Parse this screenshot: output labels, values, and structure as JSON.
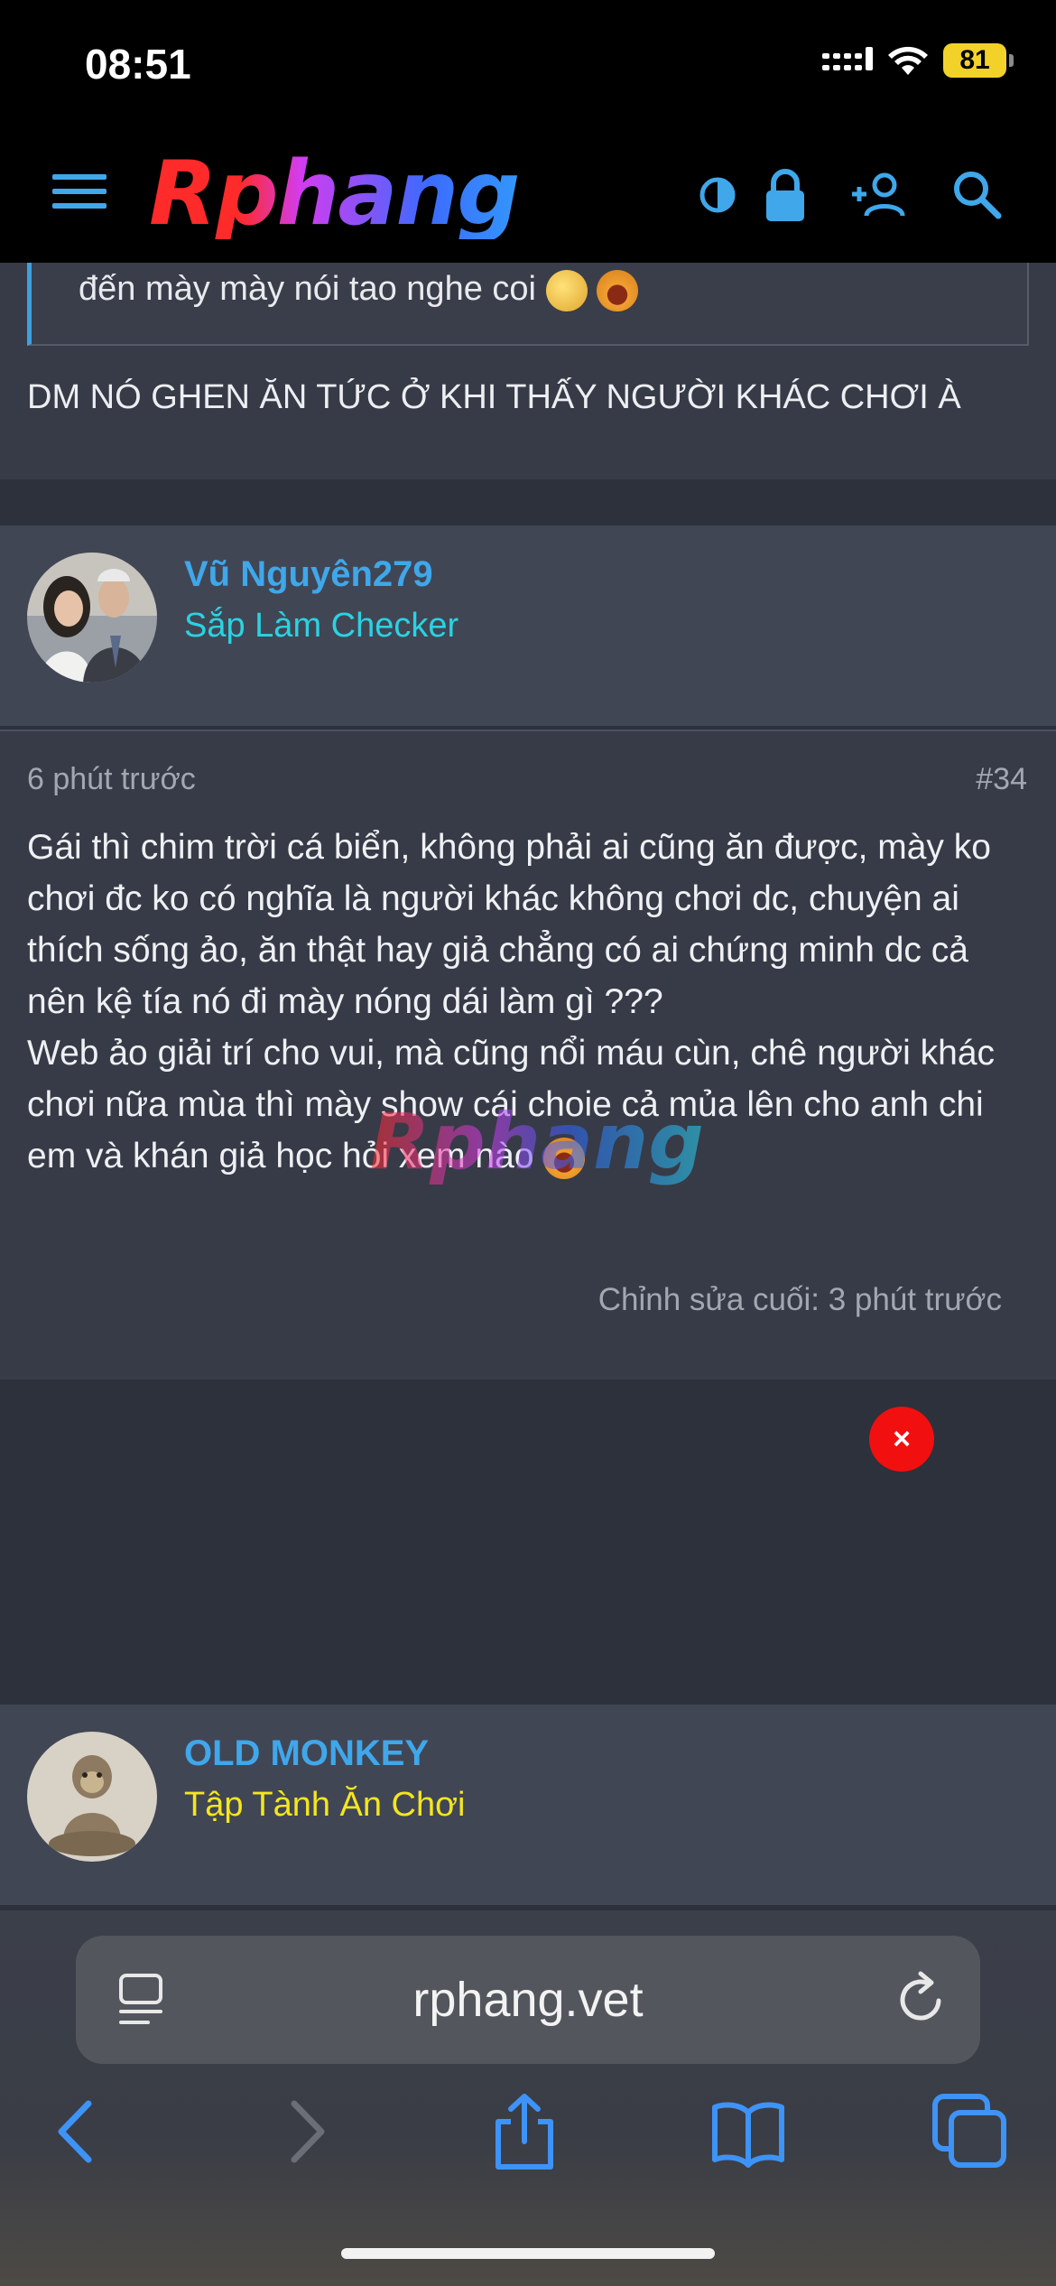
{
  "status_bar": {
    "time": "08:51",
    "battery": "81"
  },
  "header": {
    "logo": "Rphang"
  },
  "prev_post": {
    "quote_text": "đến mày mày nói tao nghe coi",
    "body": "DM NÓ GHEN ĂN TỨC Ở KHI THẤY NGƯỜI KHÁC CHƠI À"
  },
  "post": {
    "author": "Vũ Nguyên279",
    "author_title": "Sắp Làm Checker",
    "author_title_color": "#29d3e3",
    "time": "6 phút trước",
    "number": "#34",
    "paragraph1": "Gái thì chim trời cá biển, không phải ai cũng ăn được, mày ko chơi đc ko có nghĩa là người khác không chơi dc, chuyện ai thích sống ảo, ăn thật hay giả chẳng có ai chứng minh dc cả nên kệ tía nó đi mày nóng dái làm gì ???",
    "paragraph2": "Web ảo giải trí cho vui, mà cũng nổi máu cùn, chê người khác chơi nữa mùa thì mày show cái choie cả mủa lên cho anh chi em và khán giả học hỏi xem nào",
    "edited": "Chỉnh sửa cuối: 3 phút trước",
    "watermark": "Rphang"
  },
  "ad": {
    "close_label": "×"
  },
  "next_post": {
    "author": "OLD MONKEY",
    "author_title": "Tập Tành Ăn Chơi",
    "author_title_color": "#f4e61d"
  },
  "browser": {
    "url": "rphang.vet"
  }
}
